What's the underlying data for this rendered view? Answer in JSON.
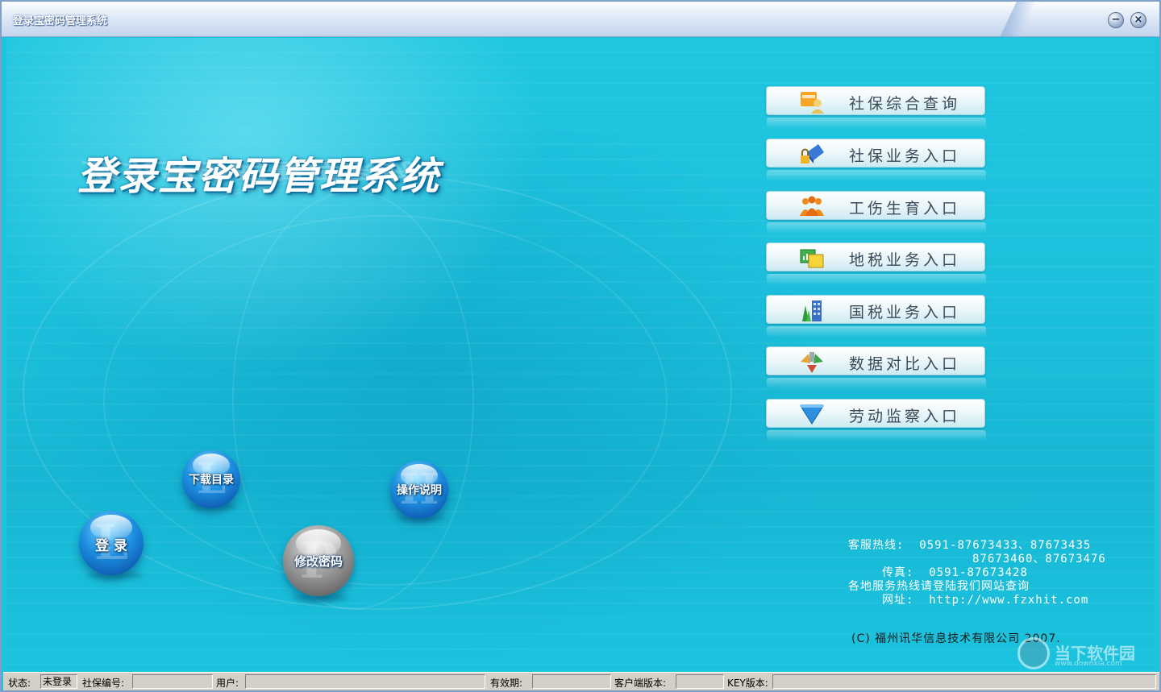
{
  "window": {
    "title": "登录宝密码管理系统",
    "minimize_symbol": "−",
    "close_symbol": "×"
  },
  "logo": {
    "title": "登录宝密码管理系统"
  },
  "menu": {
    "items": [
      {
        "label": "社保综合查询",
        "icon": "person-folder-icon"
      },
      {
        "label": "社保业务入口",
        "icon": "lock-card-icon"
      },
      {
        "label": "工伤生育入口",
        "icon": "people-group-icon"
      },
      {
        "label": "地税业务入口",
        "icon": "chart-folders-icon"
      },
      {
        "label": "国税业务入口",
        "icon": "building-trees-icon"
      },
      {
        "label": "数据对比入口",
        "icon": "compare-arrows-icon"
      },
      {
        "label": "劳动监察入口",
        "icon": "funnel-icon"
      }
    ]
  },
  "actions": {
    "login": "登 录",
    "download": "下载目录",
    "change_password": "修改密码",
    "manual": "操作说明"
  },
  "contact": {
    "hotline_label": "客服热线:",
    "hotline_1": "0591-87673433、87673435",
    "hotline_2": "87673460、87673476",
    "fax_label": "传真:",
    "fax": "0591-87673428",
    "note": "各地服务热线请登陆我们网站查询",
    "site_label": "网址:",
    "site": "http://www.fzxhit.com"
  },
  "copyright": "(C) 福州讯华信息技术有限公司 2007.",
  "watermark": {
    "text": "当下软件园",
    "url": "www.downxia.com"
  },
  "status_bar": {
    "state_label": "状态:",
    "state_value": "未登录",
    "ss_number_label": "社保编号:",
    "ss_number_value": "",
    "user_label": "用户:",
    "user_value": "",
    "expiry_label": "有效期:",
    "expiry_value": "",
    "client_version_label": "客户端版本:",
    "client_version_value": "",
    "key_version_label": "KEY版本:",
    "key_version_value": ""
  }
}
